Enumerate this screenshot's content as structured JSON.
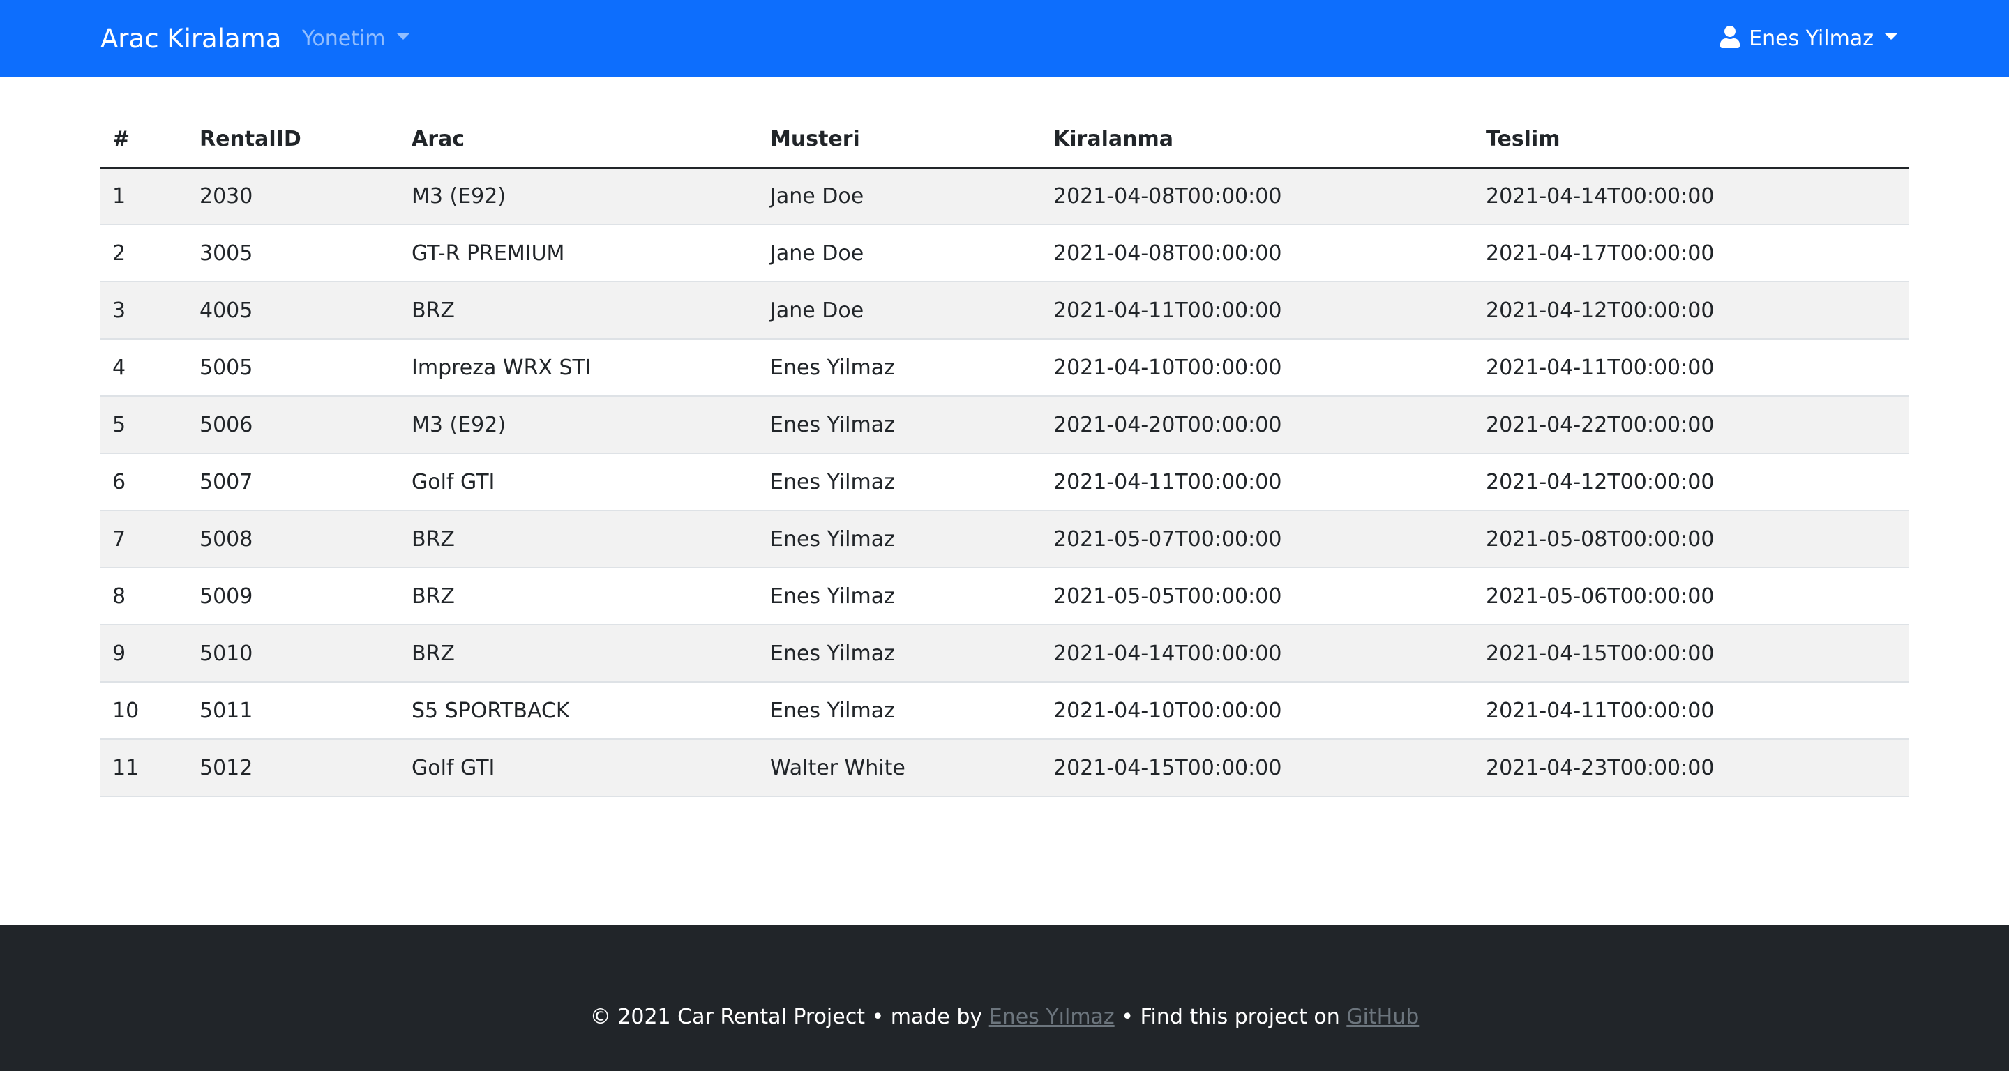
{
  "navbar": {
    "brand": "Arac Kiralama",
    "menu_label": "Yonetim",
    "user_name": "Enes Yilmaz",
    "background": "#0d6efd"
  },
  "table": {
    "headers": [
      "#",
      "RentalID",
      "Arac",
      "Musteri",
      "Kiralanma",
      "Teslim"
    ],
    "rows": [
      [
        "1",
        "2030",
        "M3 (E92)",
        "Jane Doe",
        "2021-04-08T00:00:00",
        "2021-04-14T00:00:00"
      ],
      [
        "2",
        "3005",
        "GT-R PREMIUM",
        "Jane Doe",
        "2021-04-08T00:00:00",
        "2021-04-17T00:00:00"
      ],
      [
        "3",
        "4005",
        "BRZ",
        "Jane Doe",
        "2021-04-11T00:00:00",
        "2021-04-12T00:00:00"
      ],
      [
        "4",
        "5005",
        "Impreza WRX STI",
        "Enes Yilmaz",
        "2021-04-10T00:00:00",
        "2021-04-11T00:00:00"
      ],
      [
        "5",
        "5006",
        "M3 (E92)",
        "Enes Yilmaz",
        "2021-04-20T00:00:00",
        "2021-04-22T00:00:00"
      ],
      [
        "6",
        "5007",
        "Golf GTI",
        "Enes Yilmaz",
        "2021-04-11T00:00:00",
        "2021-04-12T00:00:00"
      ],
      [
        "7",
        "5008",
        "BRZ",
        "Enes Yilmaz",
        "2021-05-07T00:00:00",
        "2021-05-08T00:00:00"
      ],
      [
        "8",
        "5009",
        "BRZ",
        "Enes Yilmaz",
        "2021-05-05T00:00:00",
        "2021-05-06T00:00:00"
      ],
      [
        "9",
        "5010",
        "BRZ",
        "Enes Yilmaz",
        "2021-04-14T00:00:00",
        "2021-04-15T00:00:00"
      ],
      [
        "10",
        "5011",
        "S5 SPORTBACK",
        "Enes Yilmaz",
        "2021-04-10T00:00:00",
        "2021-04-11T00:00:00"
      ],
      [
        "11",
        "5012",
        "Golf GTI",
        "Walter White",
        "2021-04-15T00:00:00",
        "2021-04-23T00:00:00"
      ]
    ]
  },
  "footer": {
    "prefix": "© 2021 Car Rental Project • made by ",
    "author": "Enes Yılmaz",
    "middle": " • Find this project on ",
    "repo": "GitHub",
    "background": "#212529"
  },
  "icons": {
    "user": "user-icon",
    "dropdown": "chevron-down-icon"
  }
}
